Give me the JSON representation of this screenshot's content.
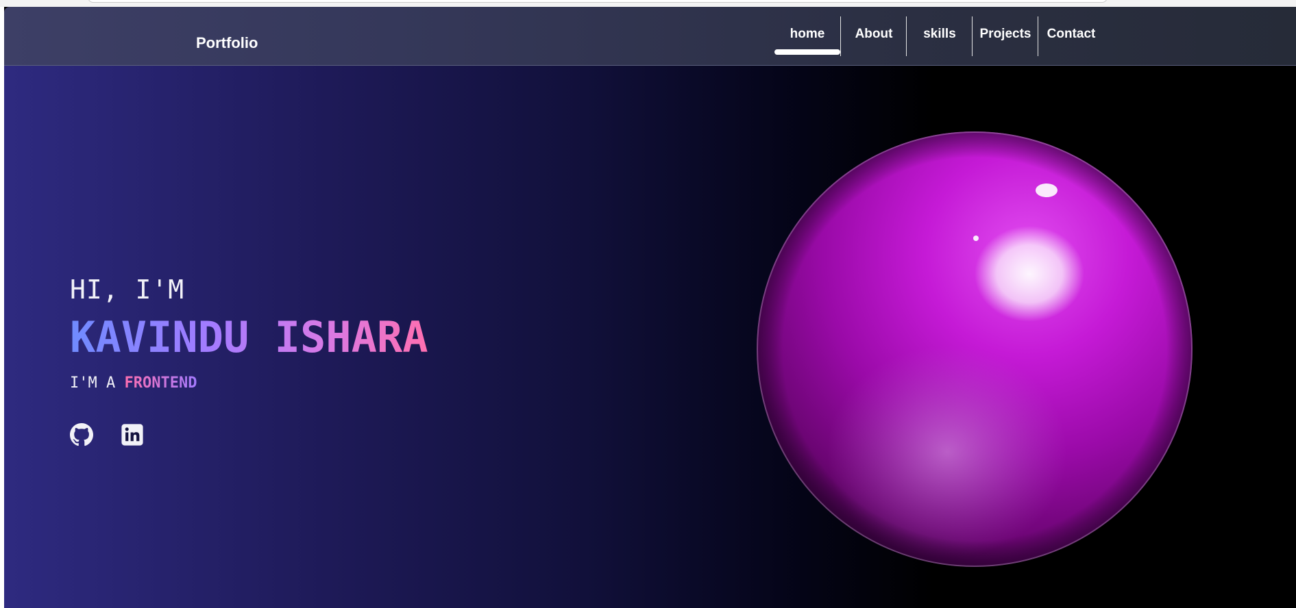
{
  "nav": {
    "brand": "Portfolio",
    "items": [
      {
        "label": "home",
        "active": true
      },
      {
        "label": "About"
      },
      {
        "label": "skills"
      },
      {
        "label": "Projects"
      },
      {
        "label": "Contact"
      }
    ]
  },
  "hero": {
    "greeting": "HI, I'M",
    "name": "KAVINDU ISHARA",
    "role_prefix": "I'M A",
    "role": "FRONTEND",
    "social": [
      {
        "icon": "github-icon"
      },
      {
        "icon": "linkedin-icon"
      }
    ]
  },
  "colors": {
    "sphere": "#b100c8",
    "name_gradient_start": "#6f8bff",
    "name_gradient_end": "#ff6fb0"
  }
}
